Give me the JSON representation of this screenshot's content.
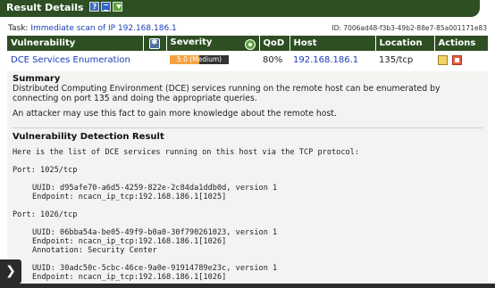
{
  "window": {
    "title": "Result Details"
  },
  "task": {
    "label": "Task:",
    "link": "Immediate scan of IP 192.168.186.1",
    "id_text": "ID: 7006ad48-f3b3-49b2-88e7-85a001171e83"
  },
  "table": {
    "headers": {
      "vulnerability": "Vulnerability",
      "severity": "Severity",
      "qod": "QoD",
      "host": "Host",
      "location": "Location",
      "actions": "Actions"
    },
    "row": {
      "vulnerability": "DCE Services Enumeration",
      "severity_label": "5.0 (Medium)",
      "severity_fraction": 0.5,
      "qod": "80%",
      "host": "192.168.186.1",
      "location": "135/tcp"
    }
  },
  "summary": {
    "title": "Summary",
    "text1": "Distributed Computing Environment (DCE) services running on the remote host can be enumerated by connecting on port 135 and doing the appropriate queries.",
    "text2": "An attacker may use this fact to gain more knowledge about the remote host."
  },
  "detection": {
    "title": "Vulnerability Detection Result",
    "intro": "Here is the list of DCE services running on this host via the TCP protocol:",
    "port1": "Port: 1025/tcp",
    "p1_uuid": "UUID: d95afe70-a6d5-4259-822e-2c84da1ddb0d, version 1",
    "p1_endpoint": "Endpoint: ncacn_ip_tcp:192.168.186.1[1025]",
    "port2": "Port: 1026/tcp",
    "p2_uuid": "UUID: 06bba54a-be05-49f9-b0a0-30f790261023, version 1",
    "p2_endpoint": "Endpoint: ncacn_ip_tcp:192.168.186.1[1026]",
    "p2_annotation": "Annotation: Security Center",
    "p3_uuid": "UUID: 30adc50c-5cbc-46ce-9a0e-91914789e23c, version 1",
    "p3_endpoint": "Endpoint: ncacn_ip_tcp:192.168.186.1[1026]"
  },
  "colors": {
    "header_green": "#2d4f23",
    "link_blue": "#1a3db8",
    "severity_orange": "#f4a340"
  },
  "icons": {
    "help": "help-icon",
    "list": "list-icon",
    "download": "download-icon",
    "solution_type": "solution-type-icon",
    "qod_type": "severity-type-icon",
    "report": "report-icon",
    "note": "add-note-icon",
    "expand": "chevron-right-icon"
  }
}
